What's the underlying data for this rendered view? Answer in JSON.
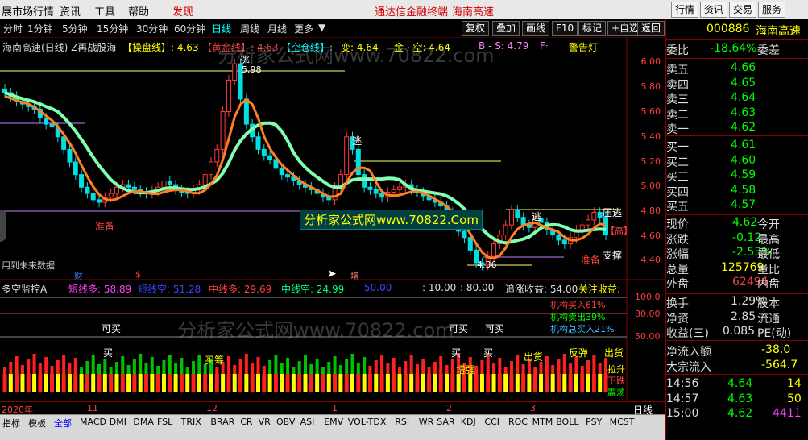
{
  "menubar": {
    "items": [
      "展市场行情",
      "资讯",
      "工具",
      "帮助",
      "发现"
    ],
    "center_title": "通达信金融终端",
    "center_stock": "海南高速",
    "right_buttons": [
      "行情",
      "资讯",
      "交易",
      "服务"
    ]
  },
  "timeframes": [
    "分时",
    "1分钟",
    "5分钟",
    "15分钟",
    "30分钟",
    "60分钟",
    "日线",
    "周线",
    "月线",
    "更多"
  ],
  "active_timeframe": "日线",
  "toolbar": [
    "复权",
    "叠加",
    "画线",
    "F10",
    "标记",
    "+自选",
    "返回"
  ],
  "chart_header": {
    "name": "海南高速(日线) Z再战股海",
    "caopan": "【操盘线】: 4.63",
    "huangjin": "【黄金线】: 4.63",
    "kongcang": "【空仓线】:",
    "bian": "变: 4.64",
    "jinkong": "金 · 空: 4.64",
    "bs": "B - S: 4.79",
    "f": "F·",
    "alarm": "警告灯"
  },
  "yticks": [
    "6.00",
    "5.80",
    "5.60",
    "5.40",
    "5.20",
    "5.00",
    "4.80",
    "4.60",
    "4.40"
  ],
  "labels": {
    "escape1": "逃",
    "high": "5.98",
    "escape2": "逃",
    "escape3": "逃",
    "zhunbei": "准备",
    "low": "4.36",
    "zhunbei2": "准备",
    "zhicheng": "支撑",
    "yadian": "压逃",
    "gao": "【高】",
    "future": "用到未来数据",
    "cai": "财",
    "zeng": "增"
  },
  "watermark": "分析家公式网www.70822.com",
  "watermark_box": "分析家公式网www.70822.Com",
  "indicator": {
    "name": "多空监控A",
    "short_long": "短线多: 58.89",
    "short_empty": "短线空: 51.28",
    "mid_long": "中线多: 29.69",
    "mid_empty": "中线空: 24.99",
    "v50": "50.00",
    "v10": ": 10.00",
    "v80": ": 80.00",
    "gain": "追涨收益: 54.00",
    "focus": "关注收益:",
    "inst_buy": "机构买入61%",
    "inst_sell": "机构卖出39%",
    "inst_total": "机构总买入21%",
    "ticks": [
      "100.0",
      "80.00",
      "50.00"
    ],
    "keymai": "可买",
    "mai": "买",
    "maichou": "买筹",
    "chuhuo": "出货",
    "fantan": "反弹",
    "zhengqing": "增强",
    "lashi": "拉升",
    "xiadie": "下跌",
    "zhendang": "震荡"
  },
  "xlabels": [
    "2020年",
    "11",
    "12",
    "1",
    "2",
    "3"
  ],
  "period_label": "日线",
  "right": {
    "code": "000886",
    "name": "海南高速",
    "weibi_label": "委比",
    "weibi_val": "-18.64%",
    "weicha_label": "委差",
    "sell": [
      [
        "卖五",
        "4.66"
      ],
      [
        "卖四",
        "4.65"
      ],
      [
        "卖三",
        "4.64"
      ],
      [
        "卖二",
        "4.63"
      ],
      [
        "卖一",
        "4.62"
      ]
    ],
    "buy": [
      [
        "买一",
        "4.61"
      ],
      [
        "买二",
        "4.60"
      ],
      [
        "买三",
        "4.59"
      ],
      [
        "买四",
        "4.58"
      ],
      [
        "买五",
        "4.57"
      ]
    ],
    "stats": [
      [
        "现价",
        "4.62",
        "今开"
      ],
      [
        "涨跌",
        "-0.12",
        "最高"
      ],
      [
        "涨幅",
        "-2.53%",
        "最低"
      ],
      [
        "总量",
        "125769",
        "量比"
      ],
      [
        "外盘",
        "62494",
        "内盘"
      ]
    ],
    "stats2": [
      [
        "换手",
        "1.29%",
        "股本"
      ],
      [
        "净资",
        "2.85",
        "流通"
      ],
      [
        "收益(三)",
        "0.085",
        "PE(动)"
      ]
    ],
    "flow": [
      [
        "净流入额",
        "-38.0"
      ],
      [
        "大宗流入",
        "-564.7"
      ]
    ],
    "ticks": [
      [
        "14:56",
        "4.64",
        "14"
      ],
      [
        "14:57",
        "4.63",
        "50"
      ],
      [
        "15:00",
        "4.62",
        "4411"
      ]
    ]
  },
  "bottom_tabs": [
    "指标",
    "模板",
    "全部",
    "MACD",
    "DMI",
    "DMA",
    "FSL",
    "TRIX",
    "BRAR",
    "CR",
    "VR",
    "OBV",
    "ASI",
    "EMV",
    "VOL-TDX",
    "RSI",
    "WR",
    "SAR",
    "KDJ",
    "CCI",
    "ROC",
    "MTM",
    "BOLL",
    "PSY",
    "MCST"
  ],
  "chart_data": {
    "type": "candlestick",
    "ylim": [
      4.3,
      6.1
    ],
    "closes": [
      5.75,
      5.72,
      5.68,
      5.66,
      5.64,
      5.62,
      5.55,
      5.5,
      5.48,
      5.4,
      5.3,
      5.2,
      5.1,
      5.0,
      4.95,
      4.9,
      4.88,
      4.92,
      4.95,
      5.0,
      5.02,
      5.0,
      4.98,
      4.96,
      4.95,
      4.97,
      5.0,
      5.05,
      5.02,
      4.98,
      4.96,
      4.95,
      4.98,
      5.02,
      5.1,
      5.2,
      5.3,
      5.6,
      5.85,
      5.98,
      5.7,
      5.5,
      5.4,
      5.3,
      5.25,
      5.22,
      5.15,
      5.1,
      5.08,
      5.05,
      5.02,
      5.0,
      4.98,
      4.95,
      4.92,
      4.9,
      5.0,
      5.1,
      5.4,
      5.3,
      5.1,
      5.0,
      4.98,
      4.95,
      4.92,
      4.96,
      4.98,
      5.0,
      5.02,
      4.98,
      4.96,
      4.93,
      4.9,
      4.88,
      4.85,
      4.8,
      4.72,
      4.65,
      4.6,
      4.5,
      4.4,
      4.38,
      4.45,
      4.55,
      4.62,
      4.7,
      4.82,
      4.76,
      4.7,
      4.68,
      4.75,
      4.72,
      4.66,
      4.62,
      4.58,
      4.55,
      4.6,
      4.66,
      4.7,
      4.74,
      4.8,
      4.76,
      4.62
    ]
  }
}
